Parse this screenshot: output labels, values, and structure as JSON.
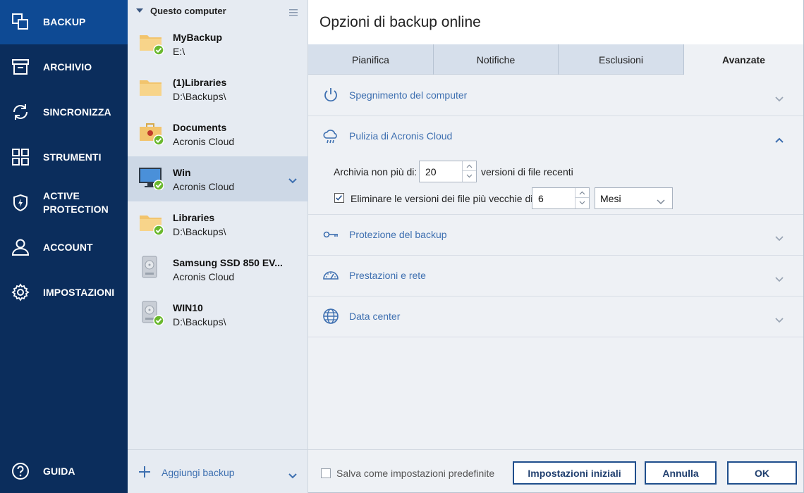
{
  "nav": {
    "items": [
      {
        "label": "BACKUP",
        "icon": "backup-copy-icon"
      },
      {
        "label": "ARCHIVIO",
        "icon": "archive-box-icon"
      },
      {
        "label": "SINCRONIZZA",
        "icon": "sync-arrows-icon"
      },
      {
        "label": "STRUMENTI",
        "icon": "tools-grid-icon"
      },
      {
        "label": "ACTIVE PROTECTION",
        "icon": "shield-bolt-icon"
      },
      {
        "label": "ACCOUNT",
        "icon": "user-icon"
      },
      {
        "label": "IMPOSTAZIONI",
        "icon": "gear-icon"
      }
    ],
    "help": {
      "label": "GUIDA",
      "icon": "question-circle-icon"
    }
  },
  "backups": {
    "header": "Questo computer",
    "items": [
      {
        "name": "MyBackup",
        "dest": "E:\\",
        "icon": "folder-icon"
      },
      {
        "name": "(1)Libraries",
        "dest": "D:\\Backups\\",
        "icon": "folder-icon"
      },
      {
        "name": "Documents",
        "dest": "Acronis Cloud",
        "icon": "briefcase-icon"
      },
      {
        "name": "Win",
        "dest": "Acronis Cloud",
        "icon": "monitor-icon"
      },
      {
        "name": "Libraries",
        "dest": "D:\\Backups\\",
        "icon": "folder-icon"
      },
      {
        "name": "Samsung SSD 850 EV...",
        "dest": "Acronis Cloud",
        "icon": "disk-icon"
      },
      {
        "name": "WIN10",
        "dest": "D:\\Backups\\",
        "icon": "disk-icon"
      }
    ],
    "add_label": "Aggiungi backup"
  },
  "panel": {
    "title": "Opzioni di backup online",
    "tabs": [
      "Pianifica",
      "Notifiche",
      "Esclusioni",
      "Avanzate"
    ],
    "active_tab": "Avanzate",
    "sections": [
      {
        "title": "Spegnimento del computer",
        "icon": "power-icon"
      },
      {
        "title": "Pulizia di Acronis Cloud",
        "icon": "cloud-rain-icon"
      },
      {
        "title": "Protezione del backup",
        "icon": "key-icon"
      },
      {
        "title": "Prestazioni e rete",
        "icon": "speedometer-icon"
      },
      {
        "title": "Data center",
        "icon": "globe-icon"
      }
    ],
    "cleanup": {
      "archive_prefix": "Archivia non più di:",
      "archive_value": "20",
      "archive_suffix": "versioni di file recenti",
      "delete_label": "Eliminare le versioni dei file più vecchie di:",
      "delete_value": "6",
      "delete_unit": "Mesi",
      "delete_checked": true
    },
    "footer": {
      "save_default_label": "Salva come impostazioni predefinite",
      "reset_label": "Impostazioni iniziali",
      "cancel_label": "Annulla",
      "ok_label": "OK"
    }
  },
  "colors": {
    "nav_bg": "#0b2d5c",
    "nav_active": "#0e4a94",
    "link_blue": "#3d6fb0",
    "ok_green": "#6ab82e"
  }
}
